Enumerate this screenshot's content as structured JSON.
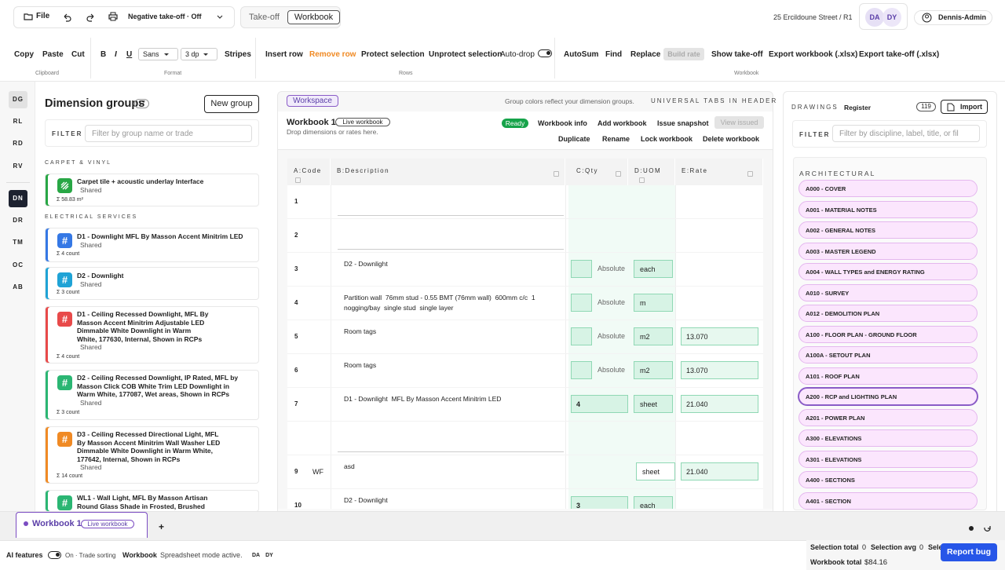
{
  "header": {
    "file": "File",
    "negative_takeoff": "Negative take-off · Off",
    "tab_takeoff": "Take-off",
    "tab_workbook": "Workbook",
    "address": "25 Ercildoune Street / R1",
    "avatar1": "DA",
    "avatar2": "DY",
    "user": "Dennis-Admin"
  },
  "ribbon": {
    "copy": "Copy",
    "paste": "Paste",
    "cut": "Cut",
    "clipboard": "Clipboard",
    "bold": "B",
    "italic": "I",
    "underline": "U",
    "font": "Sans",
    "dp": "3 dp",
    "stripes": "Stripes",
    "format": "Format",
    "insert_row": "Insert row",
    "remove_row": "Remove row",
    "protect": "Protect selection",
    "unprotect": "Unprotect selection",
    "auto_drop": "Auto-drop",
    "rows": "Rows",
    "autosum": "AutoSum",
    "find": "Find",
    "replace": "Replace",
    "build_rate": "Build rate",
    "show_takeoff": "Show take-off",
    "export_wb": "Export workbook (.xlsx)",
    "export_to": "Export take-off (.xlsx)",
    "workbook": "Workbook"
  },
  "sidebar": {
    "tags": [
      "DG",
      "RL",
      "RD",
      "RV",
      "DN",
      "DR",
      "TM",
      "OC",
      "AB"
    ]
  },
  "groups": {
    "title": "Dimension groups",
    "count": "17",
    "new": "New group",
    "filter_label": "FILTER",
    "filter_placeholder": "Filter by group name or trade",
    "section1": "CARPET & VINYL",
    "section2": "ELECTRICAL SERVICES",
    "cards": [
      {
        "title": "Carpet tile + acoustic underlay Interface",
        "shared": "Shared",
        "count": "Σ 58.83 m²",
        "color": "#28a745",
        "icon": "stripes-icon"
      },
      {
        "title": "D1 - Downlight MFL By Masson Accent Minitrim LED",
        "shared": "Shared",
        "count": "Σ 4 count",
        "color": "#3578e5",
        "icon": "hash-icon"
      },
      {
        "title": "D2 - Downlight",
        "shared": "Shared",
        "count": "Σ 3 count",
        "color": "#1fa3d6",
        "icon": "hash-icon"
      },
      {
        "title": "D1 - Ceiling Recessed Downlight, MFL By Masson Accent Minitrim Adjustable LED Dimmable White Downlight in Warm White, 177630, Internal, Shown in RCPs",
        "shared": "Shared",
        "count": "Σ 4 count",
        "color": "#e84a4a",
        "icon": "hash-icon"
      },
      {
        "title": "D2 - Ceiling Recessed Downlight, IP Rated, MFL by Masson Click COB White Trim LED Downlight in Warm White, 177087, Wet areas, Shown in RCPs",
        "shared": "Shared",
        "count": "Σ 3 count",
        "color": "#2bb673",
        "icon": "hash-icon"
      },
      {
        "title": "D3 - Ceiling Recessed Directional Light, MFL By Masson Accent Minitrim Wall Washer LED Dimmable White Downlight in Warm White, 177642, Internal, Shown in RCPs",
        "shared": "Shared",
        "count": "Σ 14 count",
        "color": "#f08a24",
        "icon": "hash-icon"
      },
      {
        "title": "WL1 - Wall Light, MFL By Masson Artisan Round Glass Shade in Frosted, Brushed",
        "shared": "",
        "count": "",
        "color": "#2bb673",
        "icon": "hash-icon"
      }
    ]
  },
  "workspace": {
    "tag": "Workspace",
    "hint": "Group colors reflect your dimension groups.",
    "universal": "UNIVERSAL TABS IN HEADER",
    "name": "Workbook 1",
    "live": "Live workbook",
    "drop": "Drop dimensions or rates here.",
    "ready": "Ready",
    "info": "Workbook info",
    "add": "Add workbook",
    "issue": "Issue snapshot",
    "view_issued": "View issued",
    "duplicate": "Duplicate",
    "rename": "Rename",
    "lock": "Lock workbook",
    "delete": "Delete workbook",
    "cols": [
      "A:Code",
      "B:Description",
      "C:Qty",
      "D:UOM",
      "E:Rate"
    ],
    "rows": [
      {
        "n": "1",
        "code": "",
        "desc": "",
        "qty": "",
        "mode": "",
        "uom": "",
        "rate": ""
      },
      {
        "n": "2",
        "code": "",
        "desc": "",
        "qty": "",
        "mode": "",
        "uom": "",
        "rate": ""
      },
      {
        "n": "3",
        "code": "",
        "desc": "D2 - Downlight",
        "qty": "",
        "mode": "Absolute",
        "uom": "each",
        "rate": ""
      },
      {
        "n": "4",
        "code": "",
        "desc": "Partition wall  76mm stud - 0.55 BMT (76mm wall)  600mm c/c  1 nogging/bay  single stud  single layer",
        "qty": "",
        "mode": "Absolute",
        "uom": "m",
        "rate": ""
      },
      {
        "n": "5",
        "code": "",
        "desc": "Room tags",
        "qty": "",
        "mode": "Absolute",
        "uom": "m2",
        "rate": "13.070"
      },
      {
        "n": "6",
        "code": "",
        "desc": "Room tags",
        "qty": "",
        "mode": "Absolute",
        "uom": "m2",
        "rate": "13.070"
      },
      {
        "n": "7",
        "code": "",
        "desc": "D1 - Downlight  MFL By Masson Accent Minitrim LED",
        "qty": "4",
        "mode": "",
        "uom": "sheet",
        "rate": "21.040"
      },
      {
        "n": "",
        "code": "",
        "desc": "",
        "qty": "",
        "mode": "",
        "uom": "",
        "rate": ""
      },
      {
        "n": "9",
        "code": "WF",
        "desc": "asd",
        "qty": "",
        "mode": "",
        "uom": "sheet",
        "rate": "21.040"
      },
      {
        "n": "10",
        "code": "",
        "desc": "D2 - Downlight",
        "qty": "3",
        "mode": "",
        "uom": "each",
        "rate": ""
      }
    ]
  },
  "drawings": {
    "title": "DRAWINGS",
    "register": "Register",
    "count": "119",
    "import": "Import",
    "filter_label": "FILTER",
    "filter_placeholder": "Filter by discipline, label, title, or fil",
    "section": "ARCHITECTURAL",
    "items": [
      "A000 - COVER",
      "A001 - MATERIAL NOTES",
      "A002 - GENERAL NOTES",
      "A003 - MASTER LEGEND",
      "A004 - WALL TYPES and ENERGY RATING",
      "A010 - SURVEY",
      "A012 - DEMOLITION PLAN",
      "A100 - FLOOR PLAN - GROUND FLOOR",
      "A100A - SETOUT PLAN",
      "A101 - ROOF PLAN",
      "A200 - RCP and LIGHTING PLAN",
      "A201 - POWER PLAN",
      "A300 - ELEVATIONS",
      "A301 - ELEVATIONS",
      "A400 - SECTIONS",
      "A401 - SECTION"
    ]
  },
  "footer": {
    "tab": "Workbook 1",
    "live": "Live workbook",
    "plus": "+",
    "ai": "AI features",
    "on": "On · Trade sorting",
    "wb": "Workbook",
    "mode": "Spreadsheet mode active.",
    "da": "DA",
    "dy": "DY",
    "sel_total": "Selection total",
    "sel_total_v": "0",
    "sel_avg": "Selection avg",
    "sel_avg_v": "0",
    "sel_more": "Sele",
    "wb_total": "Workbook total",
    "wb_total_v": "$84.16",
    "report": "Report bug"
  }
}
